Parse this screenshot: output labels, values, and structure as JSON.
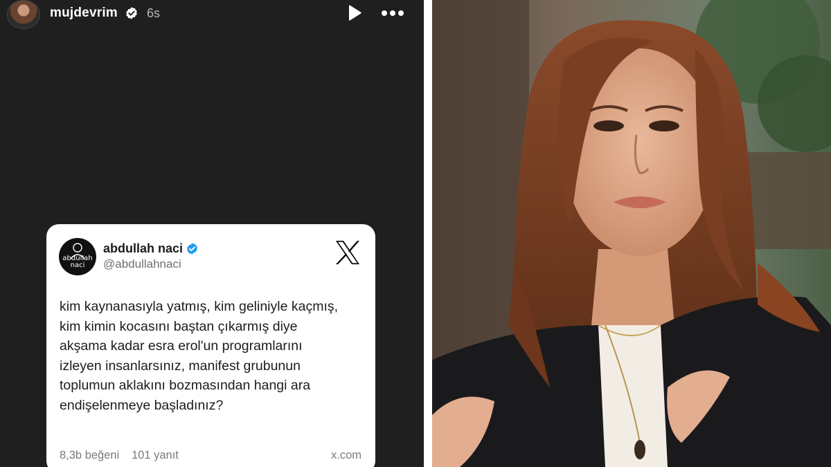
{
  "story": {
    "username": "mujdevrim",
    "time": "6s"
  },
  "tweet": {
    "avatar_text_1": "abdullah",
    "avatar_text_2": "naci",
    "name": "abdullah naci",
    "handle": "@abdullahnaci",
    "body": "kim kaynanasıyla yatmış, kim geliniyle kaçmış,\nkim kimin kocasını baştan çıkarmış diye\nakşama kadar esra erol'un programlarını\nizleyen insanlarsınız, manifest grubunun\ntoplumun aklakını bozmasından hangi ara\nendişelenmeye başladınız?",
    "likes": "8,3b beğeni",
    "replies": "101 yanıt",
    "source": "x.com"
  },
  "colors": {
    "story_bg": "#1f1f1f",
    "verified_blue": "#1d9bf0",
    "card_bg": "#ffffff"
  },
  "icons": {
    "verified": "verified-badge-icon",
    "play": "play-icon",
    "more": "more-dots-icon",
    "x_logo": "x-logo-icon"
  }
}
